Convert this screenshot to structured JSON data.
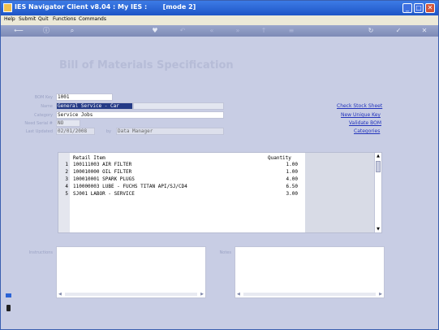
{
  "window": {
    "title": "IES Navigator Client v8.04 : My IES :       [mode 2]"
  },
  "menu": [
    "Help",
    "Submit",
    "Quit",
    "Functions",
    "Commands"
  ],
  "toolbar": [
    "back-icon",
    "info-icon",
    "search-icon",
    "heart-icon",
    "undo-icon",
    "rewind-icon",
    "forward-icon",
    "export-icon",
    "list-icon",
    "refresh-icon",
    "check-icon",
    "close-icon"
  ],
  "page": {
    "title": "Bill of Materials Specification"
  },
  "form": {
    "bom_key_label": "BOM Key",
    "bom_key": "1001",
    "name_label": "Name",
    "name": "General Service - Car",
    "category_label": "Category",
    "category": "Service Jobs",
    "need_serial_label": "Need Serial #",
    "need_serial": "NO",
    "last_updated_label": "Last Updated",
    "last_updated": "02/01/2008",
    "by_label": "by",
    "by": "Data Manager"
  },
  "links": {
    "check_stock": "Check Stock Sheet",
    "new_unique_key": "New Unique Key",
    "validate_bom": "Validate BOM",
    "categories": "Categories"
  },
  "grid": {
    "headers": {
      "item": "Retail Item",
      "qty": "Quantity"
    },
    "rows": [
      {
        "num": "1",
        "item": "100111003 AIR FILTER",
        "qty": "1.00"
      },
      {
        "num": "2",
        "item": "100010000 OIL FILTER",
        "qty": "1.00"
      },
      {
        "num": "3",
        "item": "100010001 SPARK PLUGS",
        "qty": "4.00"
      },
      {
        "num": "4",
        "item": "110000003 LUBE - FUCHS TITAN API/SJ/CD4",
        "qty": "6.50"
      },
      {
        "num": "5",
        "item": "SJ001 LABOR - SERVICE",
        "qty": "3.00"
      }
    ]
  },
  "memos": {
    "instructions_label": "Instructions",
    "notes_label": "Notes"
  },
  "colors": {
    "title_bar": "#2a63d6",
    "page_bg": "#c8cde4",
    "link": "#2233bb"
  }
}
